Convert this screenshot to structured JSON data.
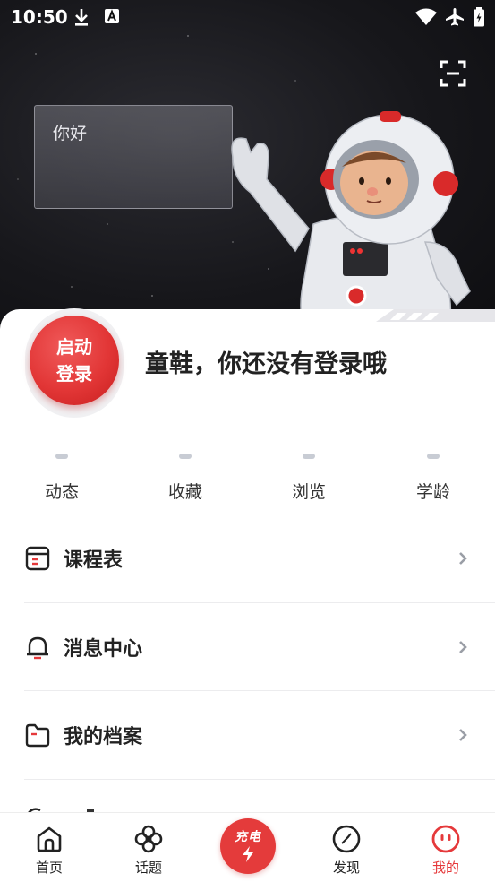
{
  "status_bar": {
    "time": "10:50"
  },
  "hero": {
    "greeting": "你好"
  },
  "profile": {
    "login_line1": "启动",
    "login_line2": "登录",
    "title": "童鞋，你还没有登录哦"
  },
  "stats": [
    {
      "label": "动态"
    },
    {
      "label": "收藏"
    },
    {
      "label": "浏览"
    },
    {
      "label": "学龄"
    }
  ],
  "menu": [
    {
      "label": "课程表",
      "icon": "schedule-icon"
    },
    {
      "label": "消息中心",
      "icon": "bell-icon"
    },
    {
      "label": "我的档案",
      "icon": "folder-icon"
    }
  ],
  "bottom_nav": {
    "home": "首页",
    "topics": "话题",
    "charge": "充电",
    "discover": "发现",
    "mine": "我的"
  },
  "colors": {
    "accent": "#e5393b",
    "hero_bg": "#17171b"
  }
}
